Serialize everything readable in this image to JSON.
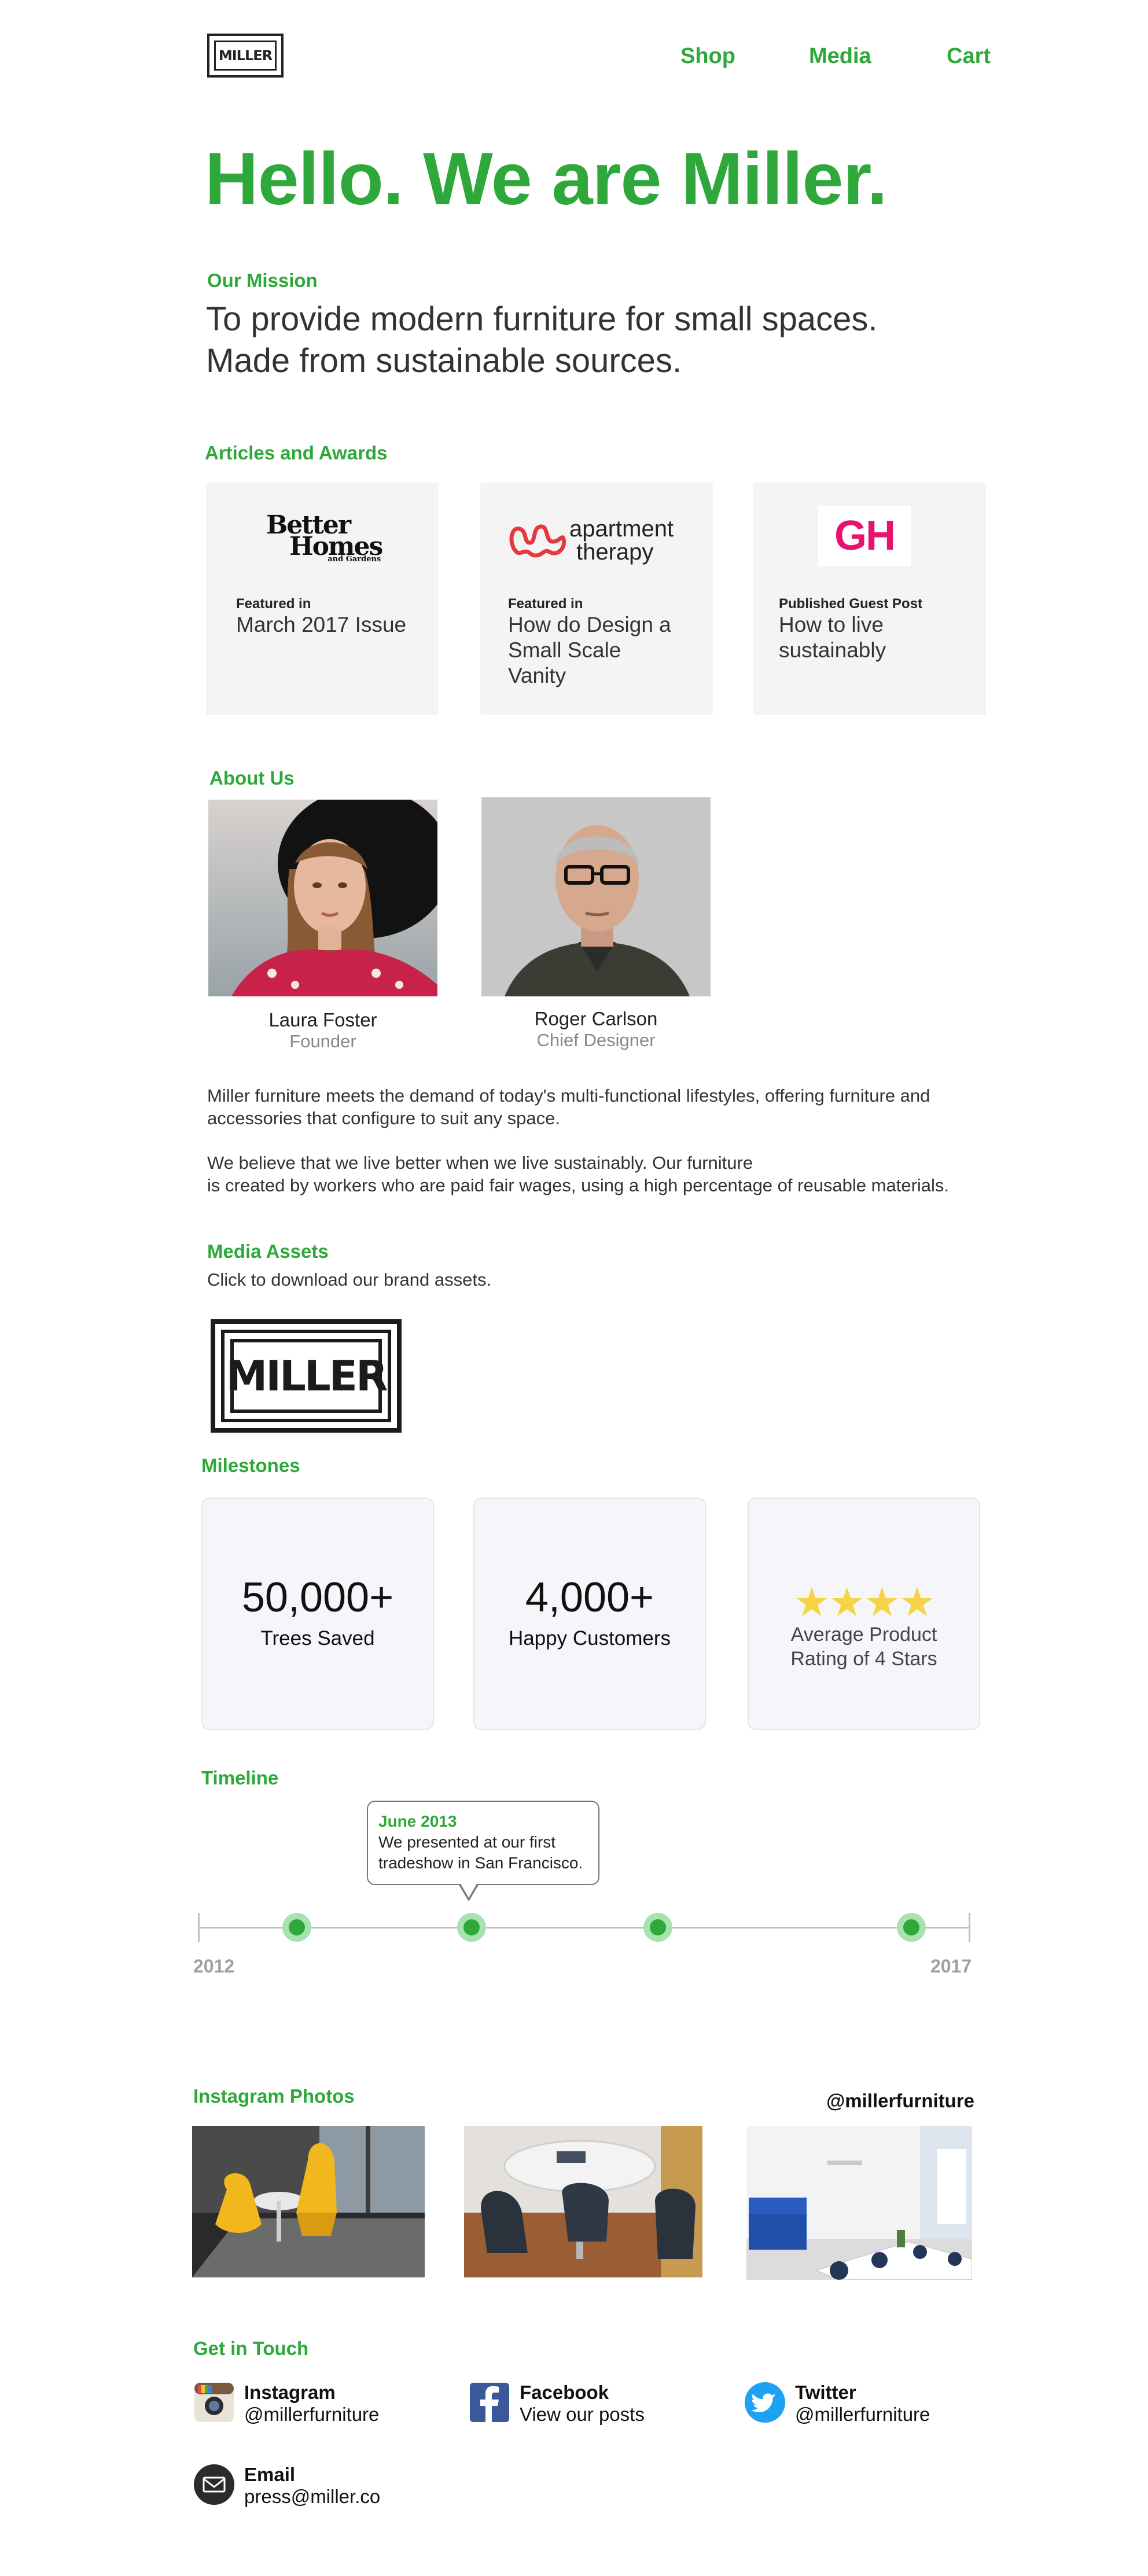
{
  "header": {
    "logo_text": "MILLER",
    "nav": [
      "Shop",
      "Media",
      "Cart"
    ]
  },
  "hero": {
    "title": "Hello. We are Miller."
  },
  "mission": {
    "heading": "Our Mission",
    "line1": "To provide modern furniture for small spaces.",
    "line2": "Made from sustainable sources."
  },
  "articles": {
    "heading": "Articles and Awards",
    "items": [
      {
        "logo": "Better Homes and Gardens",
        "logo_l1": "Better",
        "logo_l2": "Homes",
        "logo_l3": "and Gardens",
        "kicker": "Featured in",
        "title": "March 2017 Issue"
      },
      {
        "logo": "apartment therapy",
        "logo_l1": "apartment",
        "logo_l2": "therapy",
        "kicker": "Featured in",
        "title": "How do Design a Small Scale Vanity"
      },
      {
        "logo": "GH",
        "kicker": "Published Guest Post",
        "title": "How to live sustainably"
      }
    ]
  },
  "about": {
    "heading": "About Us",
    "people": [
      {
        "name": "Laura Foster",
        "role": "Founder"
      },
      {
        "name": "Roger Carlson",
        "role": "Chief Designer"
      }
    ],
    "para1_l1": "Miller furniture meets the demand of today's multi-functional lifestyles, offering furniture and",
    "para1_l2": "accessories that configure to suit any space.",
    "para2_l1": "We believe that we live better when we live sustainably. Our furniture",
    "para2_l2": "is created by workers who are paid fair wages, using a high percentage of reusable materials."
  },
  "media": {
    "heading": "Media Assets",
    "sub": "Click to download our brand assets.",
    "logo_text": "MILLER"
  },
  "milestones": {
    "heading": "Milestones",
    "items": [
      {
        "value": "50,000+",
        "label": "Trees Saved"
      },
      {
        "value": "4,000+",
        "label": "Happy Customers"
      },
      {
        "rating": 4,
        "stars": "★★★★",
        "label_l1": "Average Product",
        "label_l2": "Rating of 4 Stars"
      }
    ]
  },
  "timeline": {
    "heading": "Timeline",
    "start": "2012",
    "end": "2017",
    "tooltip_date": "June 2013",
    "tooltip_l1": "We presented at our first",
    "tooltip_l2": "tradeshow in San Francisco."
  },
  "instagram": {
    "heading": "Instagram Photos",
    "handle": "@millerfurniture"
  },
  "contact": {
    "heading": "Get in Touch",
    "items": [
      {
        "name": "Instagram",
        "value": "@millerfurniture",
        "icon": "instagram-icon"
      },
      {
        "name": "Facebook",
        "value": "View our posts",
        "icon": "facebook-icon"
      },
      {
        "name": "Twitter",
        "value": "@millerfurniture",
        "icon": "twitter-icon"
      },
      {
        "name": "Email",
        "value": "press@miller.co",
        "icon": "email-icon"
      }
    ]
  },
  "colors": {
    "brand_green": "#2ea83a",
    "star_yellow": "#f6d446",
    "gh_pink": "#e5126e"
  }
}
